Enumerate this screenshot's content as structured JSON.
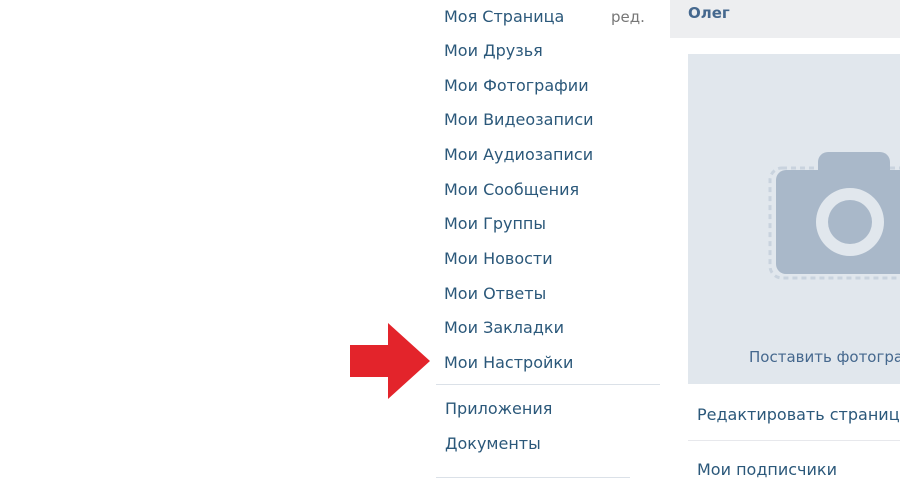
{
  "sidebar": {
    "edit_label": "ред.",
    "items": [
      {
        "label": "Моя Страница"
      },
      {
        "label": "Мои Друзья"
      },
      {
        "label": "Мои Фотографии"
      },
      {
        "label": "Мои Видеозаписи"
      },
      {
        "label": "Мои Аудиозаписи"
      },
      {
        "label": "Мои Сообщения"
      },
      {
        "label": "Мои Группы"
      },
      {
        "label": "Мои Новости"
      },
      {
        "label": "Мои Ответы"
      },
      {
        "label": "Мои Закладки"
      },
      {
        "label": "Мои Настройки"
      }
    ],
    "extra_items": [
      {
        "label": "Приложения"
      },
      {
        "label": "Документы"
      }
    ]
  },
  "profile": {
    "name": "Олег",
    "photo_label": "Поставить фотографию",
    "edit_page_label": "Редактировать страницу",
    "followers_label": "Мои подписчики"
  },
  "highlight": {
    "arrow_color": "#e3242b",
    "target": "Мои Настройки"
  },
  "colors": {
    "link": "#2b587a",
    "name": "#45688e",
    "panel_bg": "#edeef0",
    "photo_bg": "#e1e7ed",
    "camera_icon": "#a9b8c9"
  }
}
